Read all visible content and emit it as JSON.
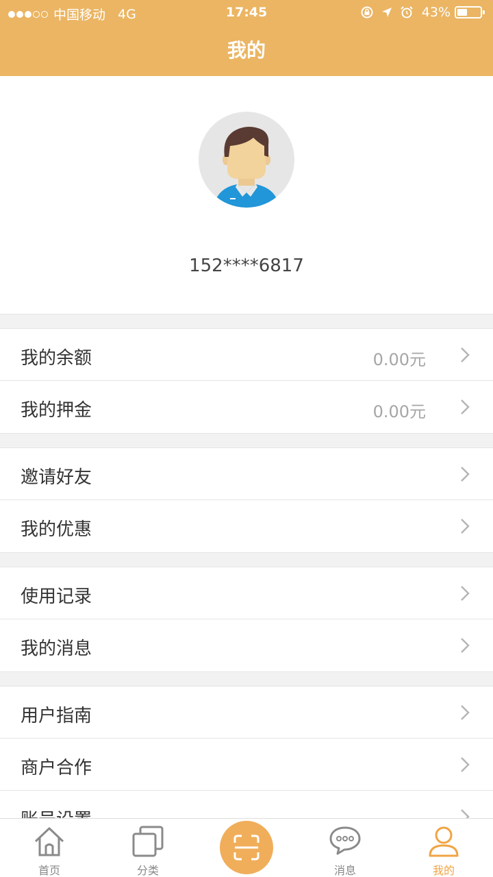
{
  "status_bar": {
    "carrier": "中国移动",
    "network": "4G",
    "time": "17:45",
    "battery": "43%",
    "battery_level": 0.43
  },
  "header": {
    "title": "我的"
  },
  "profile": {
    "phone": "152****6817"
  },
  "groups": [
    [
      {
        "label": "我的余额",
        "value": "0.00元"
      },
      {
        "label": "我的押金",
        "value": "0.00元"
      }
    ],
    [
      {
        "label": "邀请好友"
      },
      {
        "label": "我的优惠"
      }
    ],
    [
      {
        "label": "使用记录"
      },
      {
        "label": "我的消息"
      }
    ],
    [
      {
        "label": "用户指南"
      },
      {
        "label": "商户合作"
      },
      {
        "label": "账号设置"
      }
    ]
  ],
  "tabbar": {
    "home": "首页",
    "category": "分类",
    "messages": "消息",
    "mine": "我的"
  },
  "colors": {
    "accent": "#ebb563",
    "tab_active": "#f0a444"
  }
}
